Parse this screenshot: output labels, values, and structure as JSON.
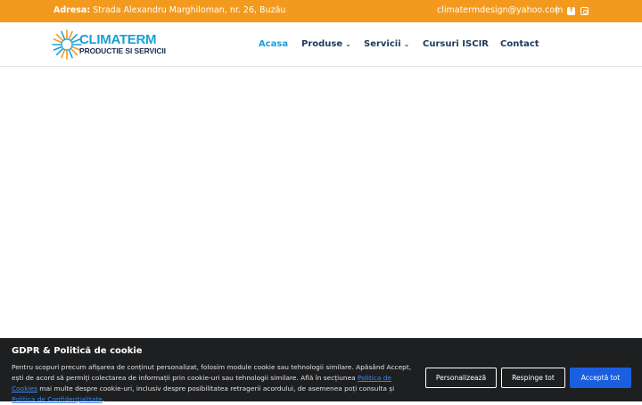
{
  "topbar": {
    "address_label": "Adresa:",
    "address_value": "Strada Alexandru Marghiloman, nr. 26, Buzău",
    "email": "climatermdesign@yahoo.com",
    "separator": "|",
    "social_icons": [
      "facebook-icon",
      "instagram-icon"
    ]
  },
  "header": {
    "logo_name": "CLIMATERM",
    "logo_tagline": "PRODUCTIE SI SERVICII",
    "nav": [
      {
        "label": "Acasa",
        "active": true
      },
      {
        "label": "Produse",
        "dropdown": true
      },
      {
        "label": "Servicii",
        "dropdown": true
      },
      {
        "label": "Cursuri ISCIR"
      },
      {
        "label": "Contact"
      }
    ],
    "chevron": "⌄"
  },
  "cookie": {
    "title": "GDPR & Politică de cookie",
    "text_part1": "Pentru scopuri precum afișarea de conținut personalizat, folosim module cookie sau tehnologii similare. Apăsând Accept, ești de acord să permiți colectarea de informații prin cookie-uri sau tehnologii similare. Află în secțiunea ",
    "link1": "Politica de Cookies",
    "text_part2": " mai multe despre cookie-uri, inclusiv despre posibilitatea retragerii acordului, de asemenea poți consulta și ",
    "link2": "Politica de Confidențialitate",
    "text_part3": ".",
    "buttons": {
      "customize": "Personalizează",
      "reject": "Respinge tot",
      "accept": "Acceptă tot"
    }
  },
  "colors": {
    "topbar": "#f39a1e",
    "nav_text": "#1b3a5c",
    "nav_active": "#1aa0d8",
    "cookie_bg": "#1e1f21",
    "accept_button": "#1a5fe0",
    "link": "#3b8af0"
  }
}
